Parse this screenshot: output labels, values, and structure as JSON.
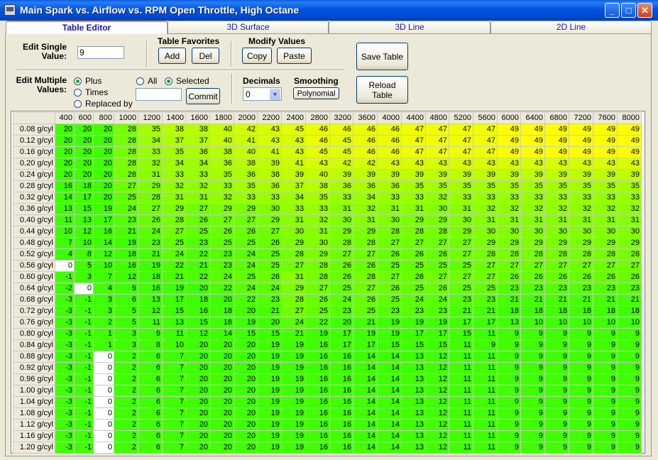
{
  "window": {
    "title": "Main Spark vs. Airflow vs. RPM Open Throttle, High Octane",
    "minimize": "_",
    "maximize": "□",
    "close": "✕"
  },
  "tabs": [
    {
      "label": "Table Editor"
    },
    {
      "label": "3D Surface"
    },
    {
      "label": "3D Line"
    },
    {
      "label": "2D Line"
    }
  ],
  "edit_single": {
    "label": "Edit Single Value:",
    "value": "9"
  },
  "favorites": {
    "label": "Table Favorites",
    "add": "Add",
    "del": "Del"
  },
  "modify": {
    "label": "Modify Values",
    "copy": "Copy",
    "paste": "Paste"
  },
  "save_table": "Save Table",
  "reload_table": "Reload Table",
  "edit_multiple": {
    "label": "Edit Multiple Values:",
    "plus": "Plus",
    "times": "Times",
    "replaced_by": "Replaced by",
    "all": "All",
    "selected": "Selected",
    "value": "",
    "commit": "Commit"
  },
  "decimals": {
    "label": "Decimals",
    "value": "0"
  },
  "smoothing": {
    "label": "Smoothing",
    "polynomial": "Polynomial"
  },
  "grid": {
    "columns": [
      "400",
      "600",
      "800",
      "1000",
      "1200",
      "1400",
      "1600",
      "1800",
      "2000",
      "2200",
      "2400",
      "2800",
      "3200",
      "3600",
      "4000",
      "4400",
      "4800",
      "5200",
      "5600",
      "6000",
      "6400",
      "6800",
      "7200",
      "7600",
      "8000"
    ],
    "rows": [
      {
        "label": "0.08 g/cyl",
        "values": [
          20,
          20,
          20,
          28,
          35,
          38,
          38,
          40,
          42,
          43,
          45,
          46,
          46,
          46,
          46,
          47,
          47,
          47,
          47,
          49,
          49,
          49,
          49,
          49,
          49
        ]
      },
      {
        "label": "0.12 g/cyl",
        "values": [
          20,
          20,
          20,
          28,
          34,
          37,
          37,
          40,
          41,
          43,
          43,
          46,
          45,
          46,
          46,
          47,
          47,
          47,
          47,
          49,
          49,
          49,
          49,
          49,
          49
        ]
      },
      {
        "label": "0.16 g/cyl",
        "values": [
          20,
          20,
          20,
          28,
          33,
          35,
          36,
          38,
          40,
          41,
          43,
          45,
          45,
          46,
          46,
          47,
          47,
          47,
          47,
          49,
          49,
          49,
          49,
          49,
          49
        ]
      },
      {
        "label": "0.20 g/cyl",
        "values": [
          20,
          20,
          20,
          28,
          32,
          34,
          34,
          36,
          38,
          39,
          41,
          43,
          42,
          42,
          43,
          43,
          43,
          43,
          43,
          43,
          43,
          43,
          43,
          43,
          43
        ]
      },
      {
        "label": "0.24 g/cyl",
        "values": [
          20,
          20,
          20,
          28,
          31,
          33,
          33,
          35,
          36,
          38,
          39,
          40,
          39,
          39,
          39,
          39,
          39,
          39,
          39,
          39,
          39,
          39,
          39,
          39,
          39
        ]
      },
      {
        "label": "0.28 g/cyl",
        "values": [
          16,
          18,
          20,
          27,
          29,
          32,
          32,
          33,
          35,
          36,
          37,
          38,
          36,
          36,
          36,
          35,
          35,
          35,
          35,
          35,
          35,
          35,
          35,
          35,
          35
        ]
      },
      {
        "label": "0.32 g/cyl",
        "values": [
          14,
          17,
          20,
          25,
          28,
          31,
          31,
          32,
          33,
          33,
          34,
          35,
          33,
          34,
          33,
          33,
          32,
          33,
          33,
          33,
          33,
          33,
          33,
          33,
          33
        ]
      },
      {
        "label": "0.36 g/cyl",
        "values": [
          13,
          15,
          19,
          24,
          27,
          29,
          27,
          29,
          29,
          30,
          33,
          33,
          31,
          32,
          31,
          31,
          30,
          31,
          32,
          32,
          32,
          32,
          32,
          32,
          32
        ]
      },
      {
        "label": "0.40 g/cyl",
        "values": [
          11,
          13,
          17,
          23,
          26,
          28,
          26,
          27,
          27,
          29,
          31,
          32,
          30,
          31,
          30,
          29,
          29,
          30,
          31,
          31,
          31,
          31,
          31,
          31,
          31
        ]
      },
      {
        "label": "0.44 g/cyl",
        "values": [
          10,
          12,
          16,
          21,
          24,
          27,
          25,
          26,
          26,
          27,
          30,
          31,
          29,
          29,
          28,
          28,
          28,
          29,
          30,
          30,
          30,
          30,
          30,
          30,
          30
        ]
      },
      {
        "label": "0.48 g/cyl",
        "values": [
          7,
          10,
          14,
          19,
          23,
          25,
          23,
          25,
          25,
          26,
          29,
          30,
          28,
          28,
          27,
          27,
          27,
          27,
          29,
          29,
          29,
          29,
          29,
          29,
          29
        ]
      },
      {
        "label": "0.52 g/cyl",
        "values": [
          4,
          8,
          12,
          18,
          21,
          24,
          22,
          23,
          24,
          25,
          28,
          29,
          27,
          27,
          26,
          26,
          26,
          27,
          28,
          28,
          28,
          28,
          28,
          28,
          28
        ]
      },
      {
        "label": "0.56 g/cyl",
        "values": [
          0,
          5,
          10,
          16,
          19,
          22,
          21,
          23,
          24,
          25,
          27,
          28,
          26,
          26,
          25,
          25,
          25,
          25,
          27,
          27,
          27,
          27,
          27,
          27,
          27
        ]
      },
      {
        "label": "0.60 g/cyl",
        "values": [
          -1,
          3,
          7,
          12,
          18,
          21,
          22,
          24,
          25,
          26,
          31,
          28,
          26,
          28,
          27,
          26,
          27,
          27,
          27,
          26,
          26,
          26,
          26,
          26,
          26
        ]
      },
      {
        "label": "0.64 g/cyl",
        "values": [
          -2,
          0,
          4,
          9,
          16,
          19,
          20,
          22,
          24,
          24,
          29,
          27,
          25,
          27,
          26,
          25,
          26,
          25,
          25,
          23,
          23,
          23,
          23,
          23,
          23
        ]
      },
      {
        "label": "0.68 g/cyl",
        "values": [
          -3,
          -1,
          3,
          6,
          13,
          17,
          18,
          20,
          22,
          23,
          28,
          26,
          24,
          26,
          25,
          24,
          24,
          23,
          23,
          21,
          21,
          21,
          21,
          21,
          21
        ]
      },
      {
        "label": "0.72 g/cyl",
        "values": [
          -3,
          -1,
          3,
          5,
          12,
          15,
          16,
          18,
          20,
          21,
          27,
          25,
          23,
          25,
          23,
          23,
          23,
          21,
          21,
          18,
          18,
          18,
          18,
          18,
          18
        ]
      },
      {
        "label": "0.76 g/cyl",
        "values": [
          -3,
          -1,
          2,
          5,
          11,
          13,
          15,
          18,
          19,
          20,
          24,
          22,
          20,
          21,
          19,
          19,
          19,
          17,
          17,
          13,
          10,
          10,
          10,
          10,
          10
        ]
      },
      {
        "label": "0.80 g/cyl",
        "values": [
          -3,
          -1,
          1,
          3,
          9,
          11,
          12,
          14,
          15,
          15,
          21,
          19,
          17,
          19,
          19,
          17,
          17,
          15,
          11,
          9,
          9,
          9,
          9,
          9,
          9
        ]
      },
      {
        "label": "0.84 g/cyl",
        "values": [
          -3,
          -1,
          1,
          3,
          8,
          10,
          20,
          20,
          20,
          19,
          19,
          16,
          17,
          17,
          15,
          15,
          15,
          11,
          9,
          9,
          9,
          9,
          9,
          9,
          9
        ]
      },
      {
        "label": "0.88 g/cyl",
        "values": [
          -3,
          -1,
          0,
          2,
          6,
          7,
          20,
          20,
          20,
          19,
          19,
          16,
          16,
          14,
          14,
          13,
          12,
          11,
          11,
          9,
          9,
          9,
          9,
          9,
          9
        ]
      },
      {
        "label": "0.92 g/cyl",
        "values": [
          -3,
          -1,
          0,
          2,
          6,
          7,
          20,
          20,
          20,
          19,
          19,
          16,
          16,
          14,
          14,
          13,
          12,
          11,
          11,
          9,
          9,
          9,
          9,
          9,
          9
        ]
      },
      {
        "label": "0.96 g/cyl",
        "values": [
          -3,
          -1,
          0,
          2,
          6,
          7,
          20,
          20,
          20,
          19,
          19,
          16,
          16,
          14,
          14,
          13,
          12,
          11,
          11,
          9,
          9,
          9,
          9,
          9,
          9
        ]
      },
      {
        "label": "1.00 g/cyl",
        "values": [
          -3,
          -1,
          0,
          2,
          6,
          7,
          20,
          20,
          20,
          19,
          19,
          16,
          16,
          14,
          14,
          13,
          12,
          11,
          11,
          9,
          9,
          9,
          9,
          9,
          9
        ]
      },
      {
        "label": "1.04 g/cyl",
        "values": [
          -3,
          -1,
          0,
          2,
          6,
          7,
          20,
          20,
          20,
          19,
          19,
          16,
          16,
          14,
          14,
          13,
          12,
          11,
          11,
          9,
          9,
          9,
          9,
          9,
          9
        ]
      },
      {
        "label": "1.08 g/cyl",
        "values": [
          -3,
          -1,
          0,
          2,
          6,
          7,
          20,
          20,
          20,
          19,
          19,
          16,
          16,
          14,
          14,
          13,
          12,
          11,
          11,
          9,
          9,
          9,
          9,
          9,
          9
        ]
      },
      {
        "label": "1.12 g/cyl",
        "values": [
          -3,
          -1,
          0,
          2,
          6,
          7,
          20,
          20,
          20,
          19,
          19,
          16,
          16,
          14,
          14,
          13,
          12,
          11,
          11,
          9,
          9,
          9,
          9,
          9,
          9
        ]
      },
      {
        "label": "1.16 g/cyl",
        "values": [
          -3,
          -1,
          0,
          2,
          6,
          7,
          20,
          20,
          20,
          19,
          19,
          16,
          16,
          14,
          14,
          13,
          12,
          11,
          11,
          9,
          9,
          9,
          9,
          9,
          9
        ]
      },
      {
        "label": "1.20 g/cyl",
        "values": [
          -3,
          -1,
          0,
          2,
          6,
          7,
          20,
          20,
          20,
          19,
          19,
          16,
          16,
          14,
          14,
          13,
          12,
          11,
          11,
          9,
          9,
          9,
          9,
          9,
          9
        ]
      }
    ],
    "selected_cells": [
      [
        12,
        0
      ],
      [
        14,
        1
      ],
      [
        20,
        2
      ],
      [
        21,
        2
      ],
      [
        22,
        2
      ],
      [
        23,
        2
      ],
      [
        24,
        2
      ],
      [
        25,
        2
      ],
      [
        26,
        2
      ],
      [
        27,
        2
      ],
      [
        28,
        2
      ]
    ],
    "colors": {
      "low": "#40ff00",
      "high": "#ffff00",
      "selected": "#ffffff",
      "header_bg": "#ece9d8"
    }
  }
}
